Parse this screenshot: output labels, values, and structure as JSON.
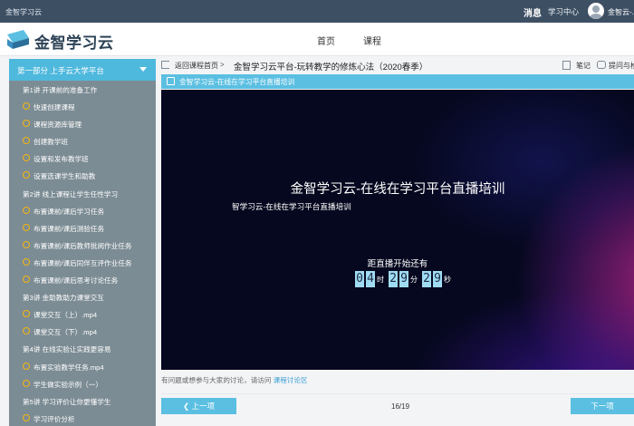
{
  "topbar": {
    "site_name": "金智学习云",
    "messages": "消息",
    "study_center": "学习中心",
    "user": "金智云-..."
  },
  "header": {
    "logo": "金智学习云",
    "nav": [
      "首页",
      "课程"
    ]
  },
  "sidebar": {
    "part_title": "第一部分 上手云大学平台",
    "rows": [
      {
        "type": "chapter",
        "label": "第1讲 开课前的准备工作"
      },
      {
        "type": "lesson",
        "label": "快速创建课程"
      },
      {
        "type": "lesson",
        "label": "课程资源库管理"
      },
      {
        "type": "lesson",
        "label": "创建教学班"
      },
      {
        "type": "lesson",
        "label": "设置和发布教学班"
      },
      {
        "type": "lesson",
        "label": "设置选课学生和助教"
      },
      {
        "type": "chapter",
        "label": "第2讲 线上课程让学生任性学习"
      },
      {
        "type": "lesson",
        "label": "布置课前/课后学习任务"
      },
      {
        "type": "lesson",
        "label": "布置课前/课后测验任务"
      },
      {
        "type": "lesson",
        "label": "布置课前/课后教师批阅作业任务"
      },
      {
        "type": "lesson",
        "label": "布置课前/课后同伴互评作业任务"
      },
      {
        "type": "lesson",
        "label": "布置课前/课后思考讨论任务"
      },
      {
        "type": "chapter",
        "label": "第3讲 金助教助力课堂交互"
      },
      {
        "type": "lesson",
        "label": "课堂交互（上）.mp4"
      },
      {
        "type": "lesson",
        "label": "课堂交互（下）.mp4"
      },
      {
        "type": "chapter",
        "label": "第4讲 在线实验让实践更容易"
      },
      {
        "type": "lesson",
        "label": "布置实验教学任务.mp4"
      },
      {
        "type": "lesson",
        "label": "学生做实验示例（一）"
      },
      {
        "type": "chapter",
        "label": "第5讲 学习评价让你更懂学生"
      },
      {
        "type": "lesson",
        "label": "学习评价分析"
      }
    ]
  },
  "breadcrumb": {
    "back": "返回课程首页",
    "separator": ">",
    "course": "金智学习云平台-玩转教学的修炼心法（2020春季）",
    "note": "笔记",
    "ask": "提问与检"
  },
  "lesson": {
    "title": "金智学习云-在线在学习平台直播培训"
  },
  "player": {
    "title": "金智学习云-在线在学习平台直播培训",
    "subtitle": "智学习云-在线在学习平台直播培训",
    "countdown_label": "距直播开始还有",
    "digits": [
      "0",
      "4",
      "2",
      "9",
      "2",
      "9"
    ],
    "units": [
      "时",
      "分",
      "秒"
    ]
  },
  "discussion": {
    "prefix": "有问题或想参与大家的讨论，请访问",
    "link": "课程讨论区"
  },
  "pager": {
    "prev": "上一项",
    "next": "下一项",
    "count": "16/19"
  },
  "colors": {
    "accent": "#5bbfe2",
    "topbar": "#3d4f63",
    "sidebar": "#7c8c94",
    "ring": "#f5b50f"
  }
}
